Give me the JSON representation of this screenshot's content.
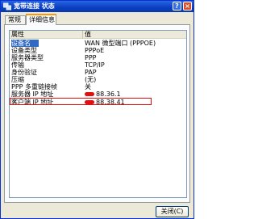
{
  "window": {
    "title": "宽带连接 状态",
    "help_label": "?",
    "close_label": "×"
  },
  "tabs": [
    {
      "label": "常规"
    },
    {
      "label": "详细信息"
    }
  ],
  "list": {
    "columns": [
      "属性",
      "值"
    ],
    "rows": [
      {
        "key": "设备名",
        "value": "WAN 微型端口 (PPPOE)"
      },
      {
        "key": "设备类型",
        "value": "PPPoE"
      },
      {
        "key": "服务器类型",
        "value": "PPP"
      },
      {
        "key": "传输",
        "value": "TCP/IP"
      },
      {
        "key": "身份验证",
        "value": "PAP"
      },
      {
        "key": "压缩",
        "value": "(无)"
      },
      {
        "key": "PPP 多重链接帧",
        "value": "关"
      },
      {
        "key": "服务器 IP 地址",
        "value": "88.36.1"
      },
      {
        "key": "客户端 IP 地址",
        "value": "88.38.41"
      }
    ]
  },
  "footer": {
    "close_button": "关闭(C)"
  }
}
